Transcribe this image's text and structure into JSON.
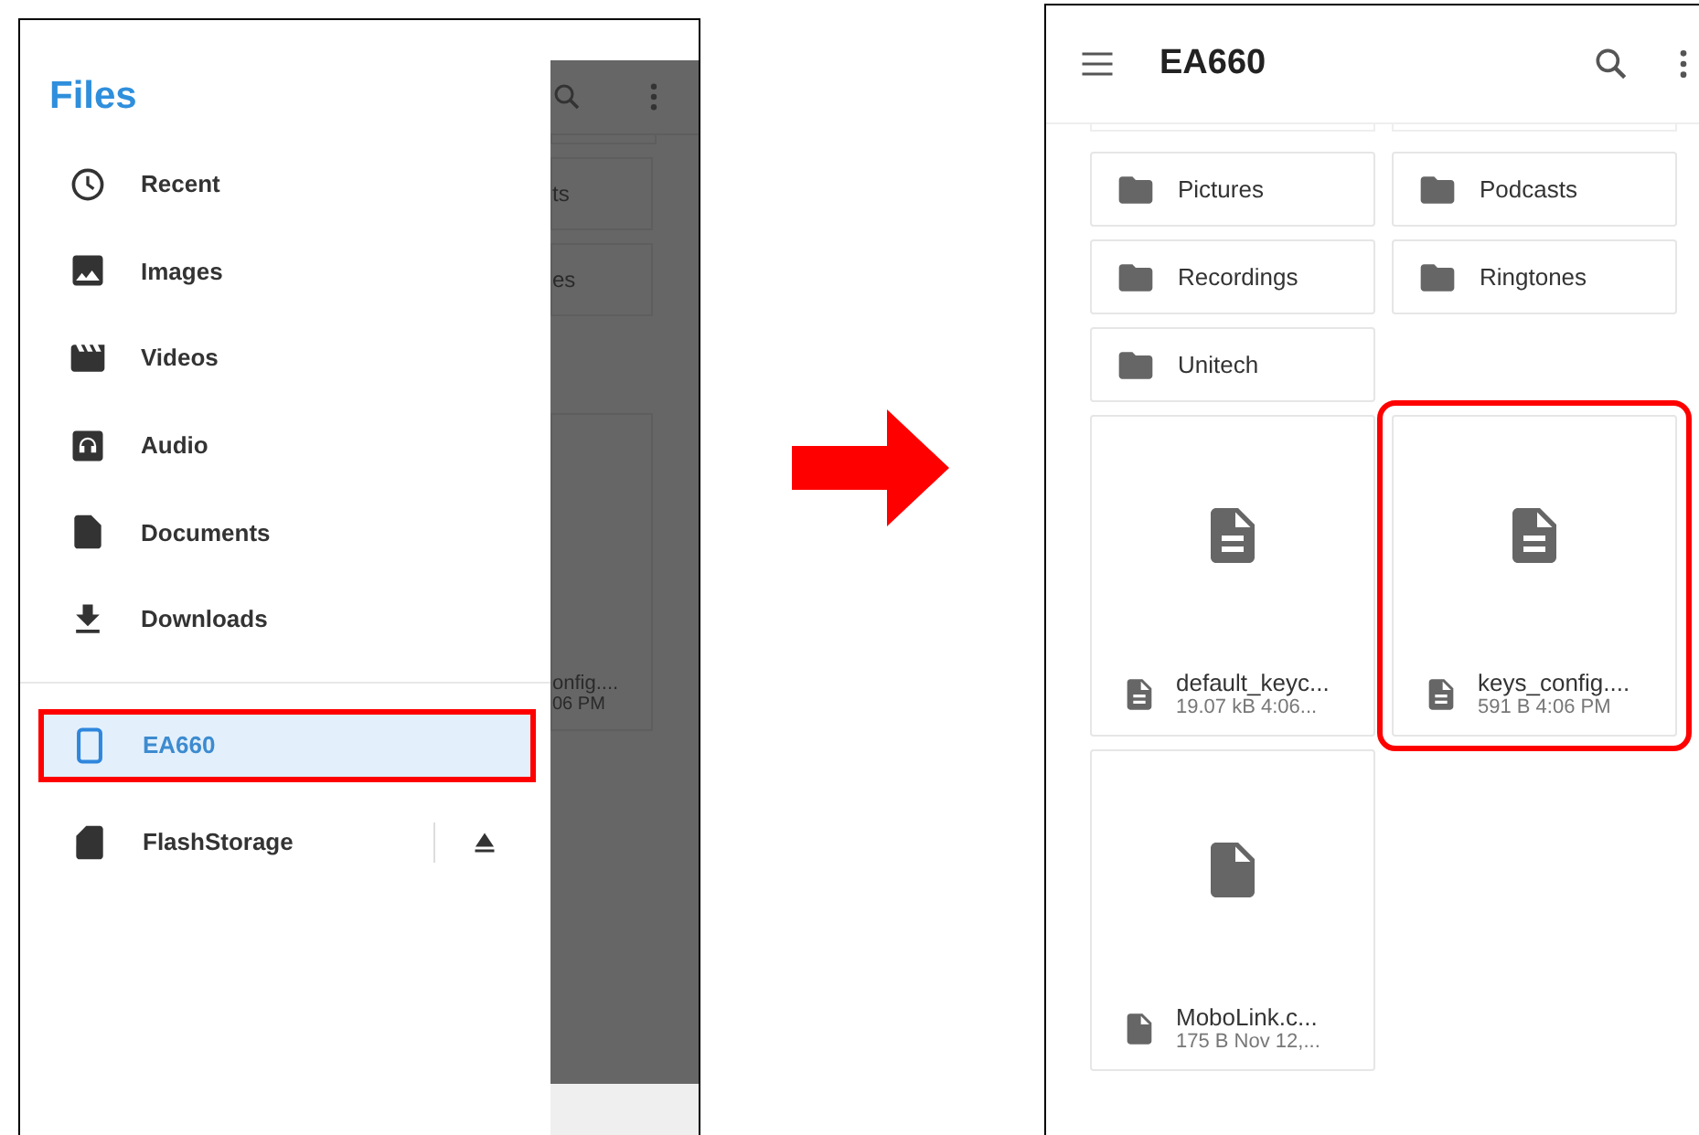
{
  "drawer": {
    "title": "Files",
    "items": [
      {
        "kind": "recent",
        "label": "Recent",
        "selected": false
      },
      {
        "kind": "images",
        "label": "Images",
        "selected": false
      },
      {
        "kind": "videos",
        "label": "Videos",
        "selected": false
      },
      {
        "kind": "audio",
        "label": "Audio",
        "selected": false
      },
      {
        "kind": "documents",
        "label": "Documents",
        "selected": false
      },
      {
        "kind": "downloads",
        "label": "Downloads",
        "selected": false
      }
    ],
    "roots": [
      {
        "kind": "device",
        "label": "EA660",
        "selected": true,
        "highlighted": true,
        "ejectable": false
      },
      {
        "kind": "sdcard",
        "label": "FlashStorage",
        "selected": false,
        "highlighted": false,
        "ejectable": true
      }
    ]
  },
  "background": {
    "folders": [
      "ts",
      "es"
    ],
    "file": {
      "name": "onfig....",
      "details": "06 PM"
    }
  },
  "browser": {
    "title": "EA660",
    "folders": [
      "Pictures",
      "Podcasts",
      "Recordings",
      "Ringtones",
      "Unitech"
    ],
    "files": [
      {
        "kind": "text",
        "name": "default_keyc...",
        "details": "19.07 kB 4:06...",
        "highlighted": false
      },
      {
        "kind": "text",
        "name": "keys_config....",
        "details": "591 B 4:06 PM",
        "highlighted": true
      },
      {
        "kind": "blank",
        "name": "MoboLink.c...",
        "details": "175 B Nov 12,...",
        "highlighted": false
      }
    ]
  }
}
